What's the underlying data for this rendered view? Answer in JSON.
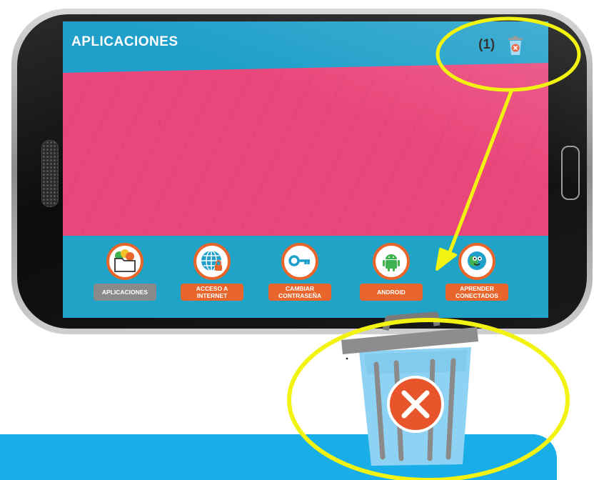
{
  "screen": {
    "title": "APLICACIONES",
    "annotation_label": "(1)"
  },
  "apps": [
    {
      "label": "APLICACIONES",
      "icon": "folder-icon",
      "selected": true
    },
    {
      "label": "ACCESO A INTERNET",
      "icon": "globe-lock-icon",
      "selected": false
    },
    {
      "label": "CAMBIAR CONTRASEÑA",
      "icon": "key-icon",
      "selected": false
    },
    {
      "label": "ANDROID",
      "icon": "android-icon",
      "selected": false
    },
    {
      "label": "APRENDER CONECTADOS",
      "icon": "earth-mascot-icon",
      "selected": false
    }
  ],
  "colors": {
    "header": "#1f9fca",
    "background": "#e9477b",
    "button": "#e8652b",
    "annotation": "#f3f312",
    "banner": "#1aaee8"
  }
}
